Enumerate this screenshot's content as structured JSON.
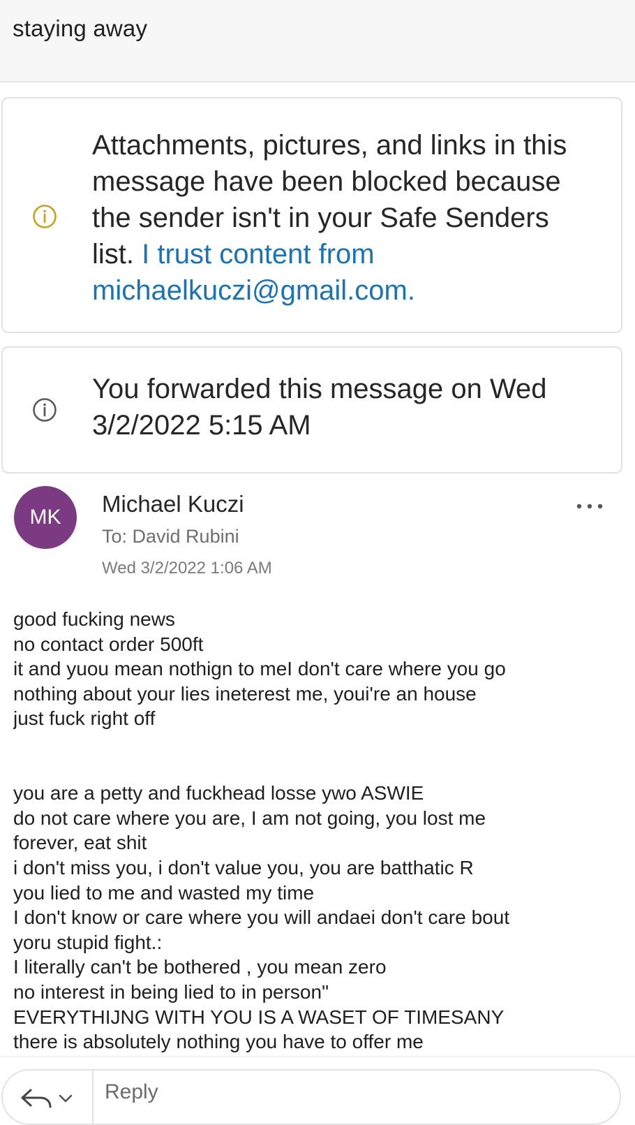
{
  "subject": "staying away",
  "notices": {
    "blocked": {
      "text": "Attachments, pictures, and links in this message have been blocked because the sender isn't in your Safe Senders list.",
      "link": "I trust content from michaelkuczi@gmail.com."
    },
    "forwarded": {
      "text": "You forwarded this message on Wed 3/2/2022 5:15 AM"
    }
  },
  "message": {
    "avatar_initials": "MK",
    "avatar_color": "#7b3a82",
    "sender": "Michael Kuczi",
    "to": "To: David Rubini",
    "date": "Wed 3/2/2022 1:06 AM",
    "body_lines": [
      "good fucking news",
      "no contact order 500ft",
      "it and yuou mean nothign to meI don't care where you go",
      "nothing about your lies ineterest me, youi're an house",
      "just fuck right off",
      "",
      "",
      "you are a petty and fuckhead losse ywo ASWIE",
      "do not care where you are,  I am not going, you lost me",
      "forever, eat shit",
      "i don't miss you, i don't value you, you are batthatic R",
      "you lied to me and wasted my time",
      "I don't know or care where you will andaei don't care bout",
      "yoru stupid fight.:",
      "I literally can't be bothered , you mean zero",
      "no interest in being lied to in person\"",
      "EVERYTHIJNG WITH YOU IS A WASET OF TIMESANY",
      "there is absolutely nothing you have to offer me"
    ]
  },
  "reply_bar": {
    "placeholder": "Reply"
  },
  "colors": {
    "link": "#1a73b6",
    "warning_icon": "#c9a21b",
    "info_icon": "#5a5a5a"
  },
  "icons": {
    "blocked_notice": "info-circle-icon-yellow",
    "forwarded_notice": "info-circle-icon",
    "more": "more-horizontal-icon",
    "reply": "reply-arrow-icon",
    "reply_options": "chevron-down-icon"
  }
}
